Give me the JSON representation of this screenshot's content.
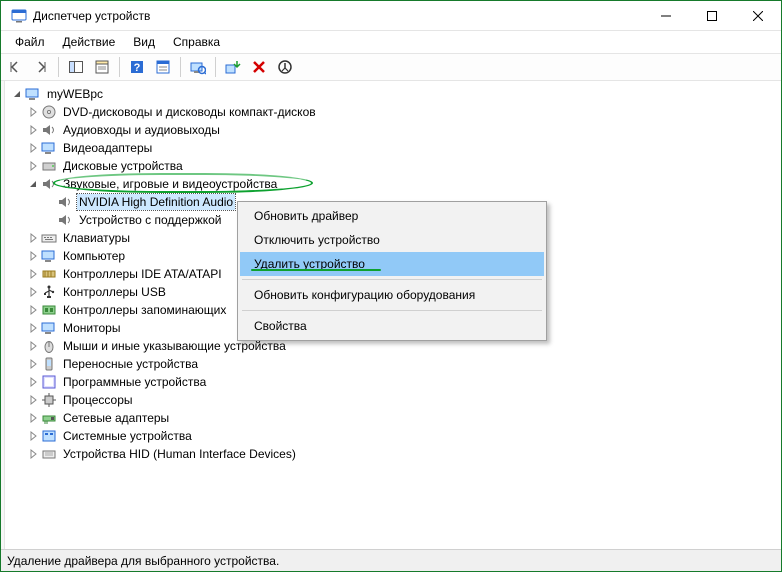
{
  "window": {
    "title": "Диспетчер устройств"
  },
  "menu": {
    "file": "Файл",
    "action": "Действие",
    "view": "Вид",
    "help": "Справка"
  },
  "tree": {
    "root": "myWEBpc",
    "nodes": {
      "dvd": "DVD-дисководы и дисководы компакт-дисков",
      "audio_io": "Аудиовходы и аудиовыходы",
      "video_adapters": "Видеоадаптеры",
      "disk_drives": "Дисковые устройства",
      "sound_game_video": "Звуковые, игровые и видеоустройства",
      "nvidia_hda": "NVIDIA High Definition Audio",
      "device_with_support": "Устройство с поддержкой",
      "keyboards": "Клавиатуры",
      "computer": "Компьютер",
      "ide_atapi": "Контроллеры IDE ATA/ATAPI",
      "usb_controllers": "Контроллеры USB",
      "storage_controllers": "Контроллеры запоминающих",
      "monitors": "Мониторы",
      "mice": "Мыши и иные указывающие устройства",
      "portable": "Переносные устройства",
      "software_devices": "Программные устройства",
      "processors": "Процессоры",
      "network_adapters": "Сетевые адаптеры",
      "system_devices": "Системные устройства",
      "hid": "Устройства HID (Human Interface Devices)"
    }
  },
  "context_menu": {
    "update_driver": "Обновить драйвер",
    "disable_device": "Отключить устройство",
    "uninstall_device": "Удалить устройство",
    "scan_hardware": "Обновить конфигурацию оборудования",
    "properties": "Свойства"
  },
  "status": {
    "text": "Удаление драйвера для выбранного устройства."
  }
}
